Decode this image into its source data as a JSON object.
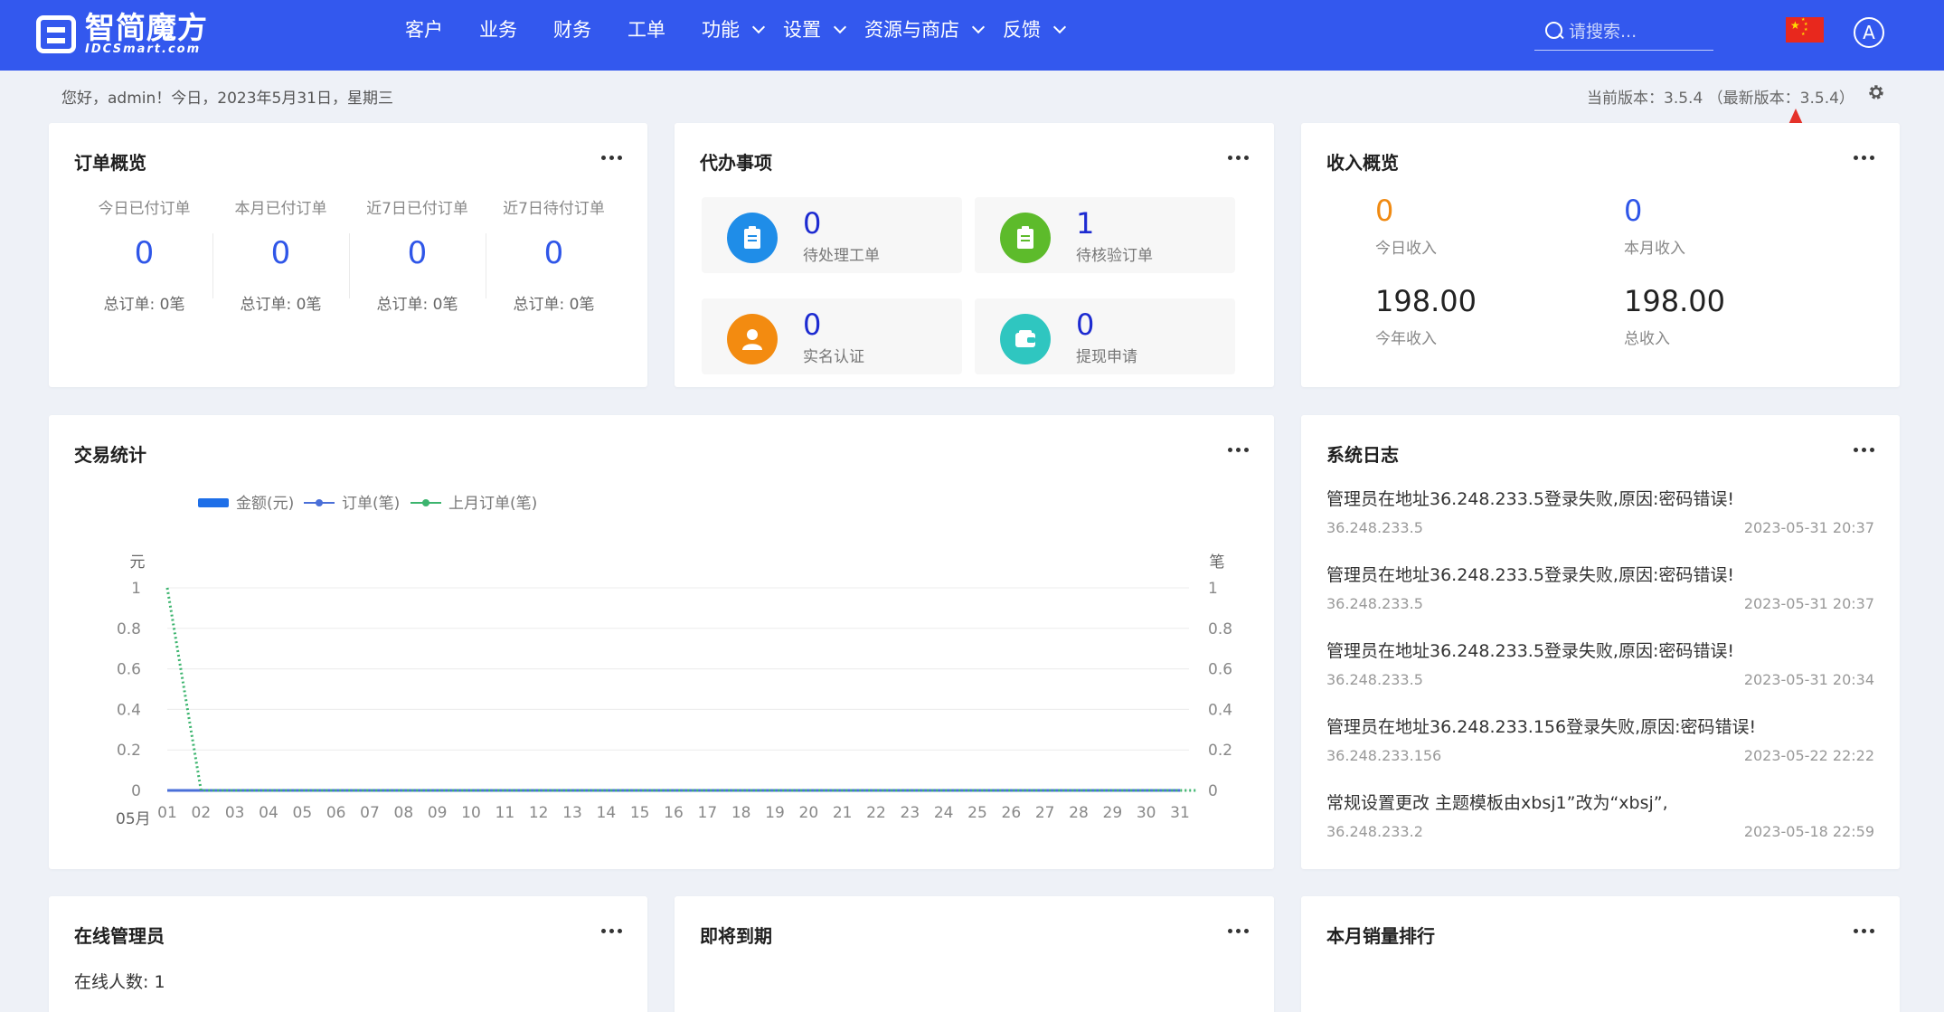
{
  "header": {
    "logo_cn": "智简魔方",
    "logo_en": "IDCSmart.com",
    "nav": [
      {
        "label": "客户",
        "dropdown": false
      },
      {
        "label": "业务",
        "dropdown": false
      },
      {
        "label": "财务",
        "dropdown": false
      },
      {
        "label": "工单",
        "dropdown": false
      },
      {
        "label": "功能",
        "dropdown": true
      },
      {
        "label": "设置",
        "dropdown": true
      },
      {
        "label": "资源与商店",
        "dropdown": true
      },
      {
        "label": "反馈",
        "dropdown": true
      }
    ],
    "search_placeholder": "请搜索...",
    "avatar_letter": "A",
    "color": "#3358ee"
  },
  "subbar": {
    "greeting": "您好，admin！今日，2023年5月31日，星期三",
    "version": "当前版本：3.5.4 （最新版本：3.5.4）"
  },
  "order_overview": {
    "title": "订单概览",
    "items": [
      {
        "label": "今日已付订单",
        "value": "0",
        "sub": "总订单: 0笔"
      },
      {
        "label": "本月已付订单",
        "value": "0",
        "sub": "总订单: 0笔"
      },
      {
        "label": "近7日已付订单",
        "value": "0",
        "sub": "总订单: 0笔"
      },
      {
        "label": "近7日待付订单",
        "value": "0",
        "sub": "总订单: 0笔"
      }
    ]
  },
  "todo": {
    "title": "代办事项",
    "items": [
      {
        "value": "0",
        "label": "待处理工单",
        "icon": "clipboard-icon",
        "color": "#1f8de8"
      },
      {
        "value": "1",
        "label": "待核验订单",
        "icon": "clipboard-check-icon",
        "color": "#5dbb2b"
      },
      {
        "value": "0",
        "label": "实名认证",
        "icon": "user-icon",
        "color": "#f38b10"
      },
      {
        "value": "0",
        "label": "提现申请",
        "icon": "wallet-icon",
        "color": "#2fc6c0"
      }
    ]
  },
  "income": {
    "title": "收入概览",
    "items": [
      {
        "value": "0",
        "label": "今日收入",
        "color": "#f08a12"
      },
      {
        "value": "0",
        "label": "本月收入",
        "color": "#2f56e8"
      },
      {
        "value": "198.00",
        "label": "今年收入",
        "color": "#222222"
      },
      {
        "value": "198.00",
        "label": "总收入",
        "color": "#222222"
      }
    ]
  },
  "trade": {
    "title": "交易统计"
  },
  "chart_data": {
    "type": "line",
    "xlabel": "05月",
    "ylabel_left": "元",
    "ylabel_right": "笔",
    "categories": [
      "01",
      "02",
      "03",
      "04",
      "05",
      "06",
      "07",
      "08",
      "09",
      "10",
      "11",
      "12",
      "13",
      "14",
      "15",
      "16",
      "17",
      "18",
      "19",
      "20",
      "21",
      "22",
      "23",
      "24",
      "25",
      "26",
      "27",
      "28",
      "29",
      "30",
      "31"
    ],
    "y_ticks": [
      "0",
      "0.2",
      "0.4",
      "0.6",
      "0.8",
      "1"
    ],
    "ylim": [
      0,
      1
    ],
    "legend_position": "top-left",
    "series": [
      {
        "name": "金额(元)",
        "kind": "bar",
        "color": "#1e6fe8",
        "values": [
          0,
          0,
          0,
          0,
          0,
          0,
          0,
          0,
          0,
          0,
          0,
          0,
          0,
          0,
          0,
          0,
          0,
          0,
          0,
          0,
          0,
          0,
          0,
          0,
          0,
          0,
          0,
          0,
          0,
          0,
          0
        ]
      },
      {
        "name": "订单(笔)",
        "kind": "line",
        "color": "#4a6fd8",
        "values": [
          0,
          0,
          0,
          0,
          0,
          0,
          0,
          0,
          0,
          0,
          0,
          0,
          0,
          0,
          0,
          0,
          0,
          0,
          0,
          0,
          0,
          0,
          0,
          0,
          0,
          0,
          0,
          0,
          0,
          0,
          0
        ]
      },
      {
        "name": "上月订单(笔)",
        "kind": "line-dotted",
        "color": "#3cb46e",
        "values": [
          1,
          0,
          0,
          0,
          0,
          0,
          0,
          0,
          0,
          0,
          0,
          0,
          0,
          0,
          0,
          0,
          0,
          0,
          0,
          0,
          0,
          0,
          0,
          0,
          0,
          0,
          0,
          0,
          0,
          0,
          0
        ]
      }
    ]
  },
  "logs": {
    "title": "系统日志",
    "items": [
      {
        "msg": "管理员在地址36.248.233.5登录失败,原因:密码错误!",
        "ip": "36.248.233.5",
        "time": "2023-05-31 20:37"
      },
      {
        "msg": "管理员在地址36.248.233.5登录失败,原因:密码错误!",
        "ip": "36.248.233.5",
        "time": "2023-05-31 20:37"
      },
      {
        "msg": "管理员在地址36.248.233.5登录失败,原因:密码错误!",
        "ip": "36.248.233.5",
        "time": "2023-05-31 20:34"
      },
      {
        "msg": "管理员在地址36.248.233.156登录失败,原因:密码错误!",
        "ip": "36.248.233.156",
        "time": "2023-05-22 22:22"
      },
      {
        "msg": "常规设置更改 主题模板由xbsj1”改为“xbsj”,",
        "ip": "36.248.233.2",
        "time": "2023-05-18 22:59"
      }
    ]
  },
  "online": {
    "title": "在线管理员",
    "count_text": "在线人数: 1"
  },
  "expiring": {
    "title": "即将到期"
  },
  "ranking": {
    "title": "本月销量排行"
  }
}
